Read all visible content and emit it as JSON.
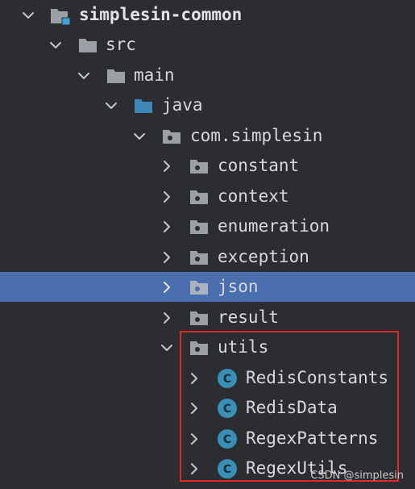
{
  "tree": {
    "items": [
      {
        "label": "simplesin-common",
        "icon": "module-folder-icon",
        "expanded": true,
        "selected": false
      },
      {
        "label": "src",
        "icon": "folder-icon",
        "expanded": true,
        "selected": false
      },
      {
        "label": "main",
        "icon": "folder-icon",
        "expanded": true,
        "selected": false
      },
      {
        "label": "java",
        "icon": "source-root-folder-icon",
        "expanded": true,
        "selected": false
      },
      {
        "label": "com.simplesin",
        "icon": "package-icon",
        "expanded": true,
        "selected": false
      },
      {
        "label": "constant",
        "icon": "package-icon",
        "expanded": false,
        "selected": false
      },
      {
        "label": "context",
        "icon": "package-icon",
        "expanded": false,
        "selected": false
      },
      {
        "label": "enumeration",
        "icon": "package-icon",
        "expanded": false,
        "selected": false
      },
      {
        "label": "exception",
        "icon": "package-icon",
        "expanded": false,
        "selected": false
      },
      {
        "label": "json",
        "icon": "package-icon",
        "expanded": false,
        "selected": true
      },
      {
        "label": "result",
        "icon": "package-icon",
        "expanded": false,
        "selected": false
      },
      {
        "label": "utils",
        "icon": "package-icon",
        "expanded": true,
        "selected": false
      },
      {
        "label": "RedisConstants",
        "icon": "class-icon",
        "expanded": false,
        "selected": false
      },
      {
        "label": "RedisData",
        "icon": "class-icon",
        "expanded": false,
        "selected": false
      },
      {
        "label": "RegexPatterns",
        "icon": "class-icon",
        "expanded": false,
        "selected": false
      },
      {
        "label": "RegexUtils",
        "icon": "class-icon",
        "expanded": false,
        "selected": false
      }
    ]
  },
  "annotation": {
    "highlight_color": "#e3262a"
  },
  "watermark": {
    "text": "CSDN @simplesin"
  },
  "colors": {
    "background": "#2b2d30",
    "selection": "#4b6eaf",
    "folder": "#9aa0a6",
    "source_root": "#3d86b8",
    "class_badge": "#3a8fb7",
    "text": "#d7d9dd"
  }
}
